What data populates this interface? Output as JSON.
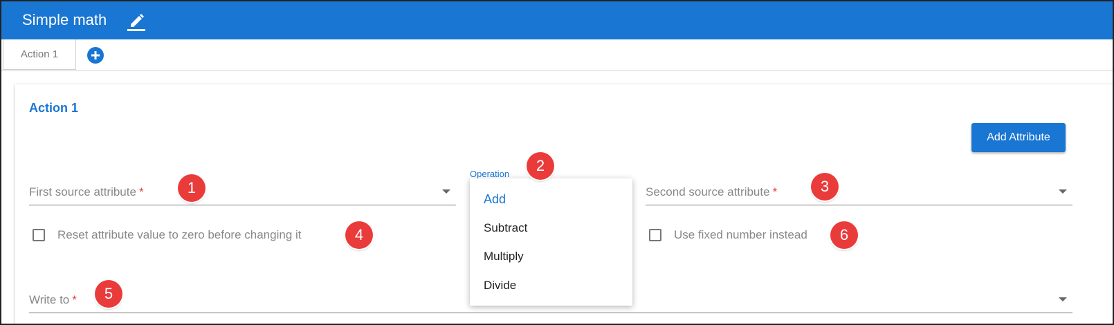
{
  "header": {
    "title": "Simple math"
  },
  "tabs": [
    {
      "label": "Action 1"
    }
  ],
  "card": {
    "title": "Action 1",
    "add_attribute_label": "Add Attribute"
  },
  "fields": {
    "first_source": {
      "label": "First source attribute",
      "required": "*"
    },
    "second_source": {
      "label": "Second source attribute",
      "required": "*"
    },
    "write_to": {
      "label": "Write to",
      "required": "*"
    }
  },
  "checkboxes": {
    "reset": {
      "label": "Reset attribute value to zero before changing it",
      "checked": false
    },
    "fixed_number": {
      "label": "Use fixed number instead",
      "checked": false
    }
  },
  "operation": {
    "label": "Operation",
    "selected": "Add",
    "options": [
      "Add",
      "Subtract",
      "Multiply",
      "Divide"
    ]
  },
  "markers": [
    "1",
    "2",
    "3",
    "4",
    "5",
    "6"
  ],
  "colors": {
    "primary": "#1976d2",
    "marker": "#ea3b3b",
    "required": "#e53935"
  }
}
